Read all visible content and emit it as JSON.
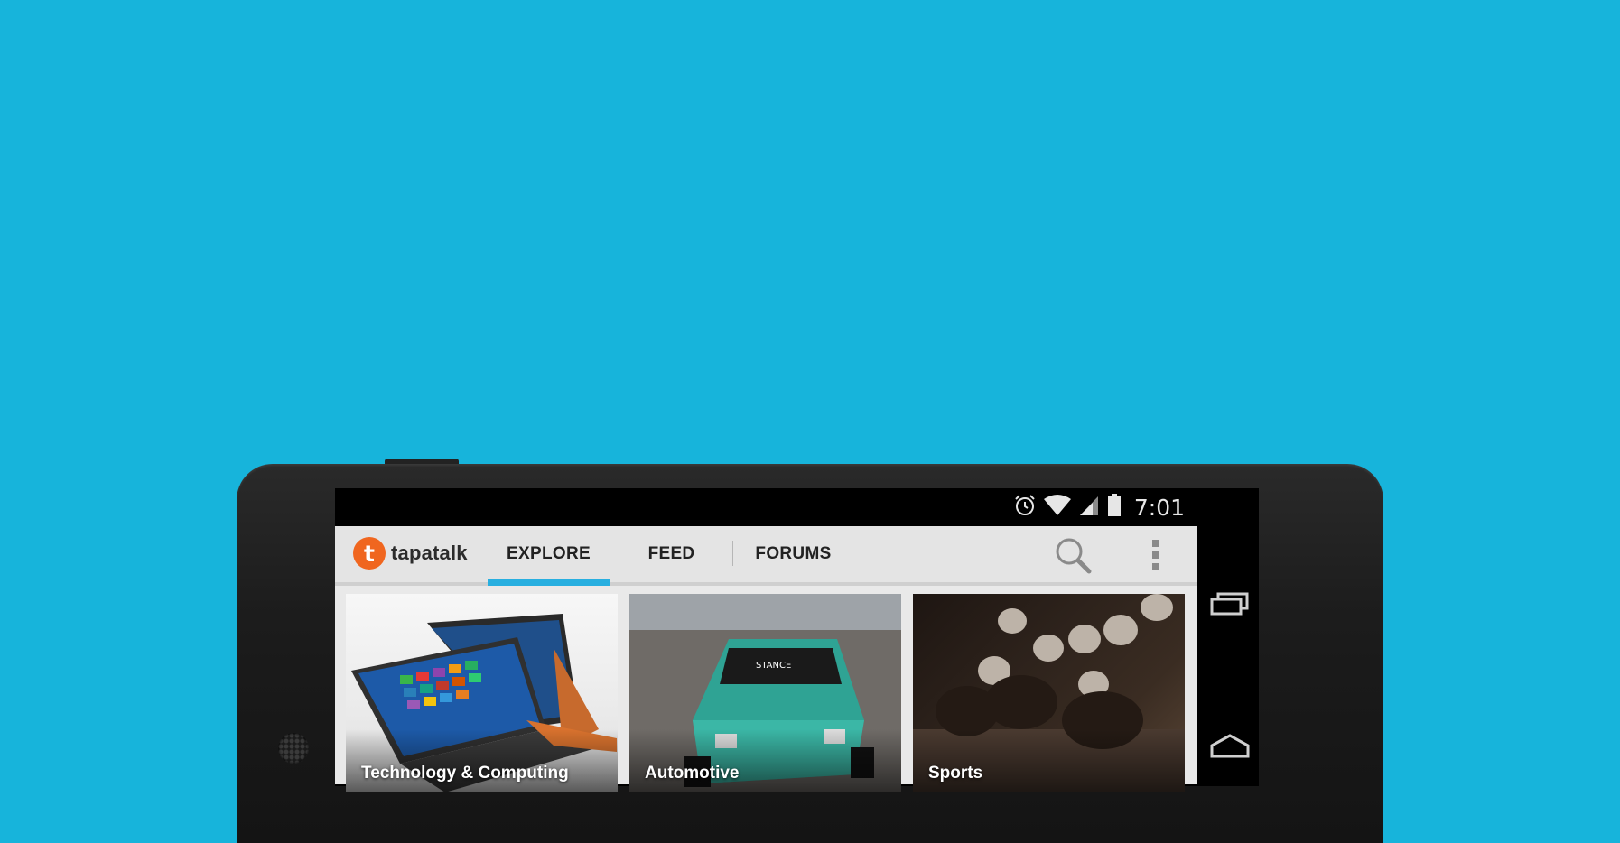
{
  "status_bar": {
    "time": "7:01",
    "icons": [
      "alarm-icon",
      "wifi-icon",
      "signal-icon",
      "battery-icon"
    ]
  },
  "app_bar": {
    "logo_text": "tapatalk",
    "logo_letter": "t",
    "tabs": [
      {
        "label": "EXPLORE",
        "selected": true
      },
      {
        "label": "FEED",
        "selected": false
      },
      {
        "label": "FORUMS",
        "selected": false
      }
    ],
    "actions": [
      "search-icon",
      "overflow-menu-icon"
    ]
  },
  "categories": [
    {
      "label": "Technology & Computing"
    },
    {
      "label": "Automotive"
    },
    {
      "label": "Sports"
    }
  ],
  "nav_bar": [
    "recents-icon",
    "home-icon"
  ],
  "colors": {
    "background": "#17b4db",
    "accent": "#28afe0",
    "logo": "#f0661f",
    "app_bar": "#e4e4e4"
  }
}
